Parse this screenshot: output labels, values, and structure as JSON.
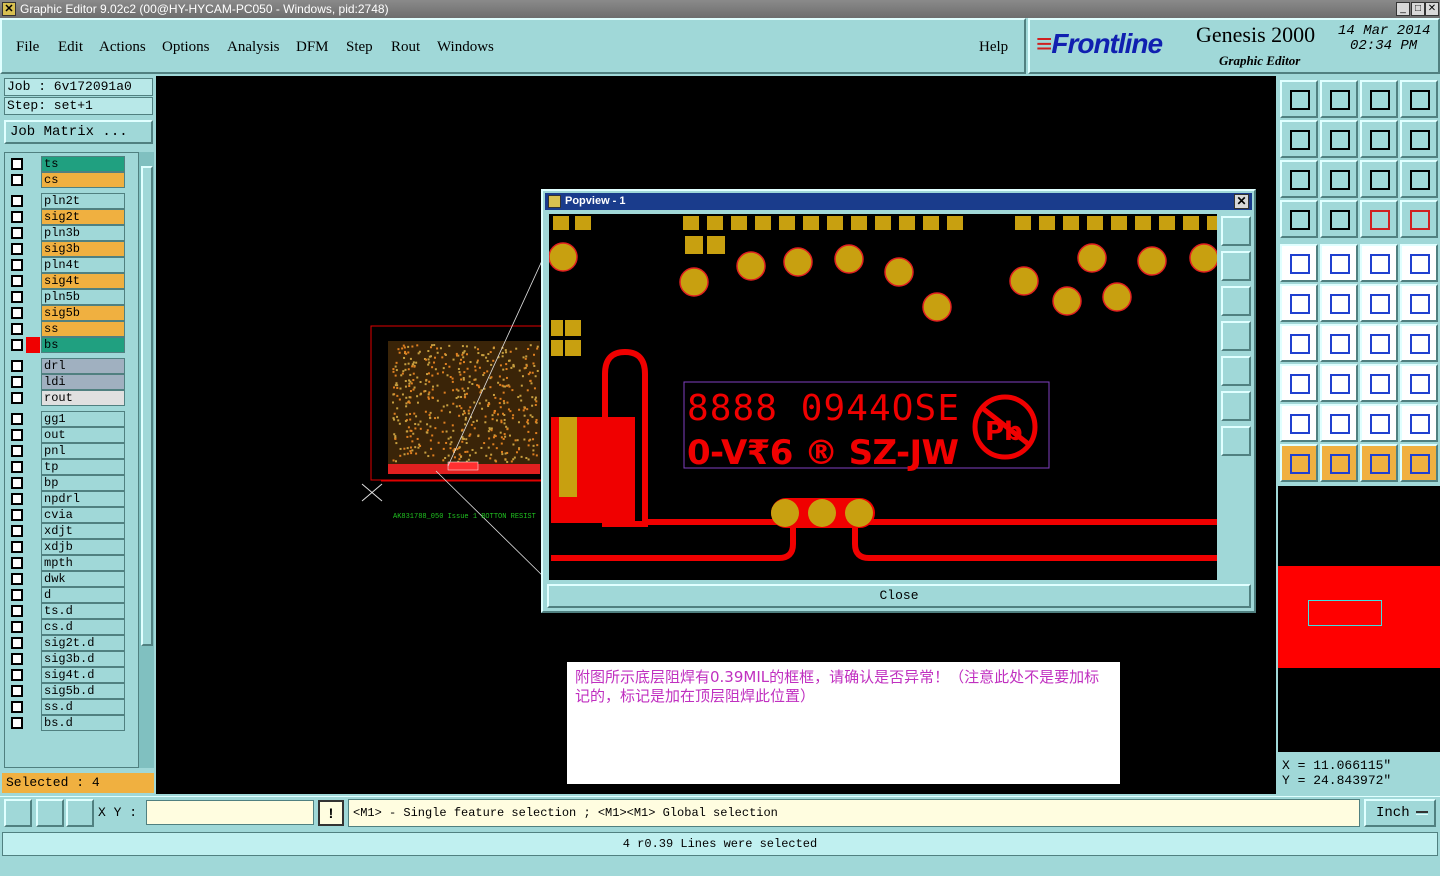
{
  "window": {
    "title": "Graphic Editor 9.02c2 (00@HY-HYCAM-PC050 - Windows, pid:2748)",
    "buttons": [
      "_",
      "□",
      "✕"
    ]
  },
  "menu": {
    "items": [
      "File",
      "Edit",
      "Actions",
      "Options",
      "Analysis",
      "DFM",
      "Step",
      "Rout",
      "Windows"
    ],
    "help": "Help"
  },
  "brand": {
    "logo": "Frontline",
    "product": "Genesis 2000",
    "subtitle": "Graphic Editor",
    "date": "14 Mar 2014",
    "time": "02:34 PM"
  },
  "job": {
    "job_label": "Job : 6v172091a0",
    "step_label": "Step: set+1",
    "matrix_button": "Job Matrix ..."
  },
  "layers": [
    {
      "name": "ts",
      "color": "#20a080"
    },
    {
      "name": "cs",
      "color": "#f0b040"
    },
    {
      "name": "pln2t",
      "color": "#a0d8d8"
    },
    {
      "name": "sig2t",
      "color": "#f0b040"
    },
    {
      "name": "pln3b",
      "color": "#a0d8d8"
    },
    {
      "name": "sig3b",
      "color": "#f0b040"
    },
    {
      "name": "pln4t",
      "color": "#a0d8d8"
    },
    {
      "name": "sig4t",
      "color": "#f0b040"
    },
    {
      "name": "pln5b",
      "color": "#a0d8d8"
    },
    {
      "name": "sig5b",
      "color": "#f0b040"
    },
    {
      "name": "ss",
      "color": "#f0b040"
    },
    {
      "name": "bs",
      "color": "#20a080",
      "active": true
    },
    {
      "name": "drl",
      "color": "#a0b0c0"
    },
    {
      "name": "ldi",
      "color": "#a0b0c0"
    },
    {
      "name": "rout",
      "color": "#e0e0e0"
    },
    {
      "name": "gg1",
      "color": "#a0d8d8"
    },
    {
      "name": "out",
      "color": "#a0d8d8"
    },
    {
      "name": "pnl",
      "color": "#a0d8d8"
    },
    {
      "name": "tp",
      "color": "#a0d8d8"
    },
    {
      "name": "bp",
      "color": "#a0d8d8"
    },
    {
      "name": "npdrl",
      "color": "#a0d8d8"
    },
    {
      "name": "cvia",
      "color": "#a0d8d8"
    },
    {
      "name": "xdjt",
      "color": "#a0d8d8"
    },
    {
      "name": "xdjb",
      "color": "#a0d8d8"
    },
    {
      "name": "mpth",
      "color": "#a0d8d8"
    },
    {
      "name": "dwk",
      "color": "#a0d8d8"
    },
    {
      "name": "d",
      "color": "#a0d8d8"
    },
    {
      "name": "ts.d",
      "color": "#a0d8d8"
    },
    {
      "name": "cs.d",
      "color": "#a0d8d8"
    },
    {
      "name": "sig2t.d",
      "color": "#a0d8d8"
    },
    {
      "name": "sig3b.d",
      "color": "#a0d8d8"
    },
    {
      "name": "sig4t.d",
      "color": "#a0d8d8"
    },
    {
      "name": "sig5b.d",
      "color": "#a0d8d8"
    },
    {
      "name": "ss.d",
      "color": "#a0d8d8"
    },
    {
      "name": "bs.d",
      "color": "#a0d8d8"
    }
  ],
  "selected": "Selected : 4",
  "canvas": {
    "board_caption": "AK831788_050 Issue 1 BOTTON RESIST"
  },
  "popview": {
    "title": "Popview - 1",
    "close_label": "Close",
    "marking_line1": "8888 0944OSE",
    "marking_line2": "0-V₹6 ® SZ-JW",
    "pb": "Pb"
  },
  "note": {
    "text": "附图所示底层阻焊有0.39MIL的框框，请确认是否异常！（注意此处不是要加标记的，标记是加在顶层阻焊此位置）"
  },
  "coords": {
    "x": "X = 11.066115\"",
    "y": "Y = 24.843972\""
  },
  "bottom": {
    "xy_label": "X Y :",
    "xy_value": "",
    "hint": "<M1> - Single feature selection ; <M1><M1> Global selection",
    "units": "Inch",
    "status": "4 r0.39 Lines were selected"
  },
  "colors": {
    "panel": "#a0d8d8",
    "pad": "#c8a010",
    "mask": "#ff0000",
    "selection": "#f0b040"
  }
}
